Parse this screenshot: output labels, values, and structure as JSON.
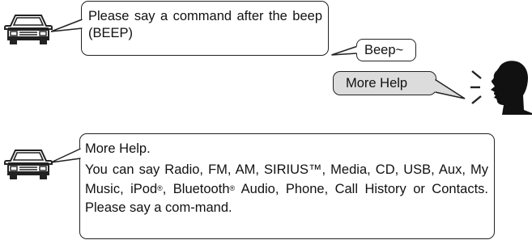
{
  "dialog1": {
    "system_prompt": "Please say a command after the beep (BEEP)",
    "beep": "Beep~",
    "user_command": "More Help"
  },
  "dialog2": {
    "line1": "More Help.",
    "part_a": "You can say Radio, FM, AM, SIRIUS™, Media, CD, USB, Aux, My Music, iPod",
    "reg1": "®",
    "part_b": ", Bluetooth",
    "reg2": "®",
    "part_c": " Audio, Phone, Call History or Contacts. Please say a com-mand."
  },
  "icons": [
    "car-icon",
    "speaking-person-icon"
  ],
  "colors": {
    "outline": "#222222",
    "user_bubble_fill": "#dcdcdc"
  }
}
